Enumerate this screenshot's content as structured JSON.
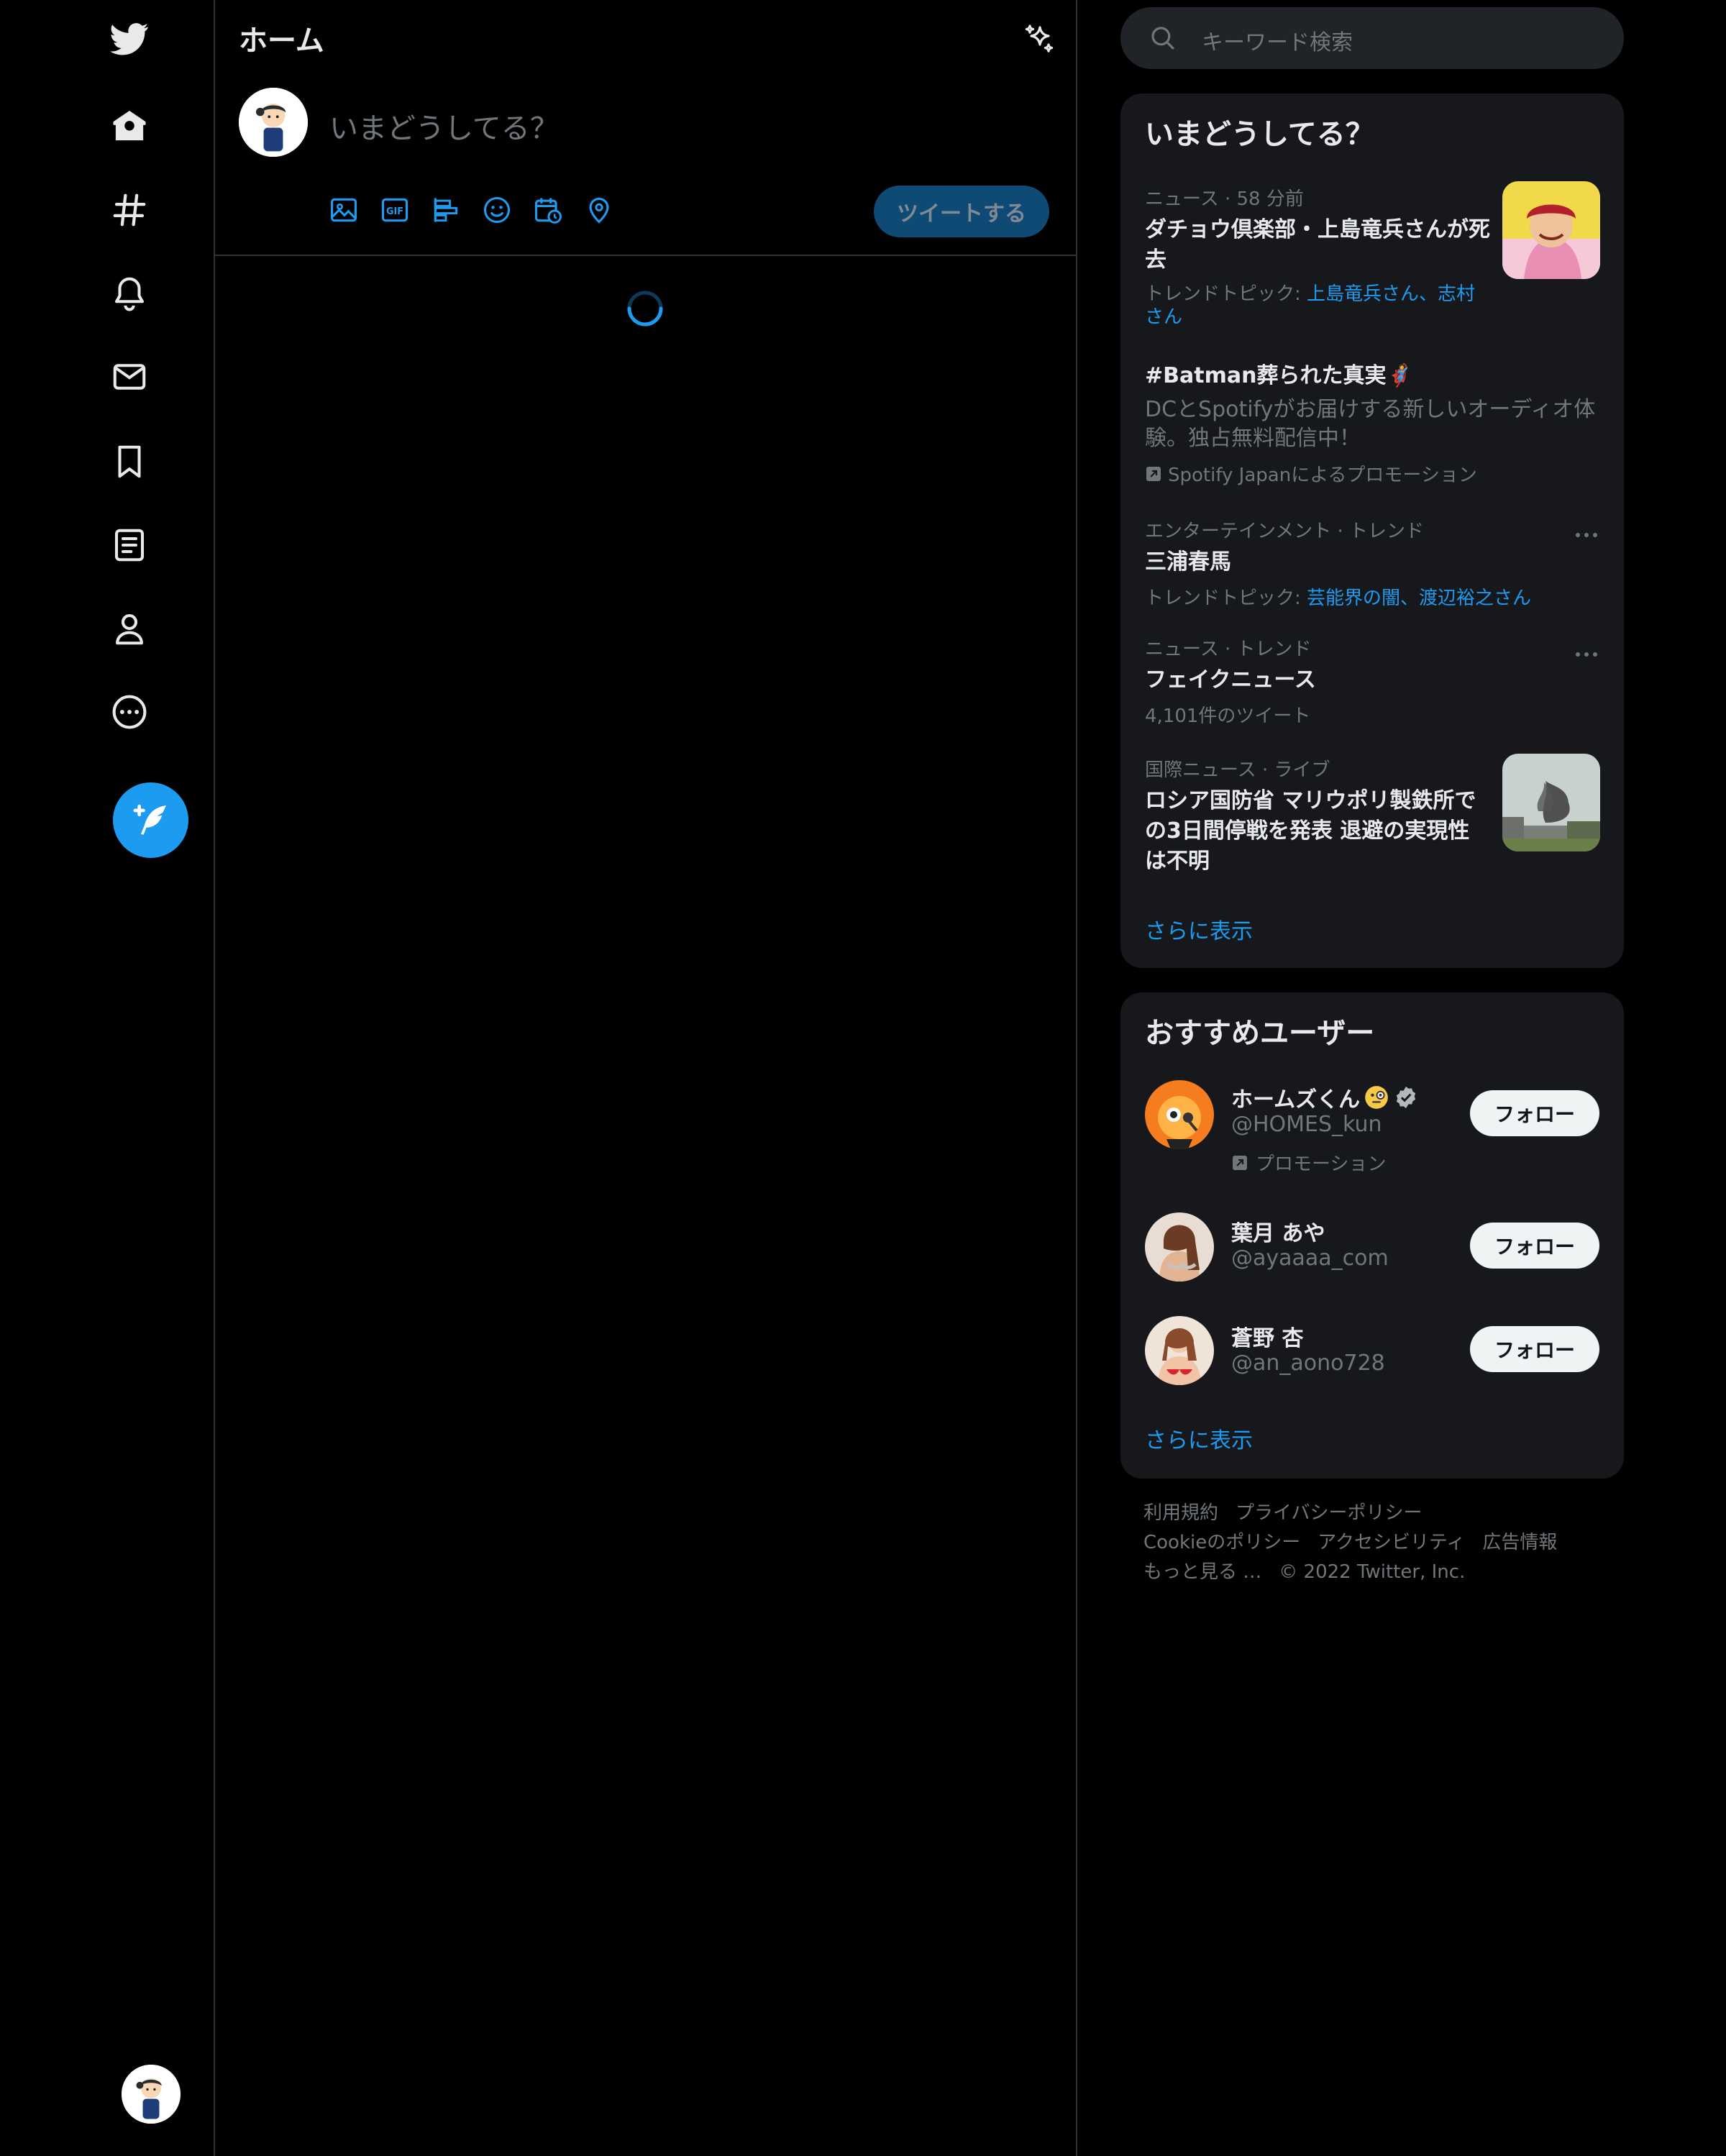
{
  "colors": {
    "accent": "#1d9bf0",
    "background": "#000000",
    "panel": "#16181c",
    "text": "#e7e9ea",
    "muted": "#71767b"
  },
  "nav": {
    "items": [
      {
        "icon": "twitter-bird-icon"
      },
      {
        "icon": "home-icon"
      },
      {
        "icon": "hashtag-icon"
      },
      {
        "icon": "bell-icon"
      },
      {
        "icon": "mail-icon"
      },
      {
        "icon": "bookmark-icon"
      },
      {
        "icon": "list-icon"
      },
      {
        "icon": "profile-icon"
      },
      {
        "icon": "more-circle-icon"
      }
    ],
    "compose_icon": "compose-feather-icon"
  },
  "main": {
    "title": "ホーム",
    "compose_placeholder": "いまどうしてる？",
    "tools": [
      "image-icon",
      "gif-icon",
      "poll-icon",
      "emoji-icon",
      "schedule-icon",
      "location-icon"
    ],
    "tweet_button": "ツイートする"
  },
  "search": {
    "placeholder": "キーワード検索"
  },
  "trends": {
    "title": "いまどうしてる？",
    "items": [
      {
        "meta": "ニュース · 58 分前",
        "headline": "ダチョウ倶楽部・上島竜兵さんが死去",
        "topic_label": "トレンドトピック: ",
        "topic_links": "上島竜兵さん、志村さん"
      },
      {
        "headline": "#Batman葬られた真実",
        "emoji": "🦸",
        "body": "DCとSpotifyがお届けする新しいオーディオ体験。独占無料配信中！",
        "promo": "Spotify Japanによるプロモーション"
      },
      {
        "meta": "エンターテインメント · トレンド",
        "headline": "三浦春馬",
        "topic_label": "トレンドトピック: ",
        "topic_links": "芸能界の闇、渡辺裕之さん"
      },
      {
        "meta": "ニュース · トレンド",
        "headline": "フェイクニュース",
        "count": "4,101件のツイート"
      },
      {
        "meta": "国際ニュース · ライブ",
        "headline": "ロシア国防省 マリウポリ製鉄所での3日間停戦を発表 退避の実現性は不明"
      }
    ],
    "show_more": "さらに表示"
  },
  "suggestions": {
    "title": "おすすめユーザー",
    "users": [
      {
        "name": "ホームズくん",
        "handle": "@HOMES_kun",
        "promo": "プロモーション",
        "follow": "フォロー"
      },
      {
        "name": "葉月 あや",
        "handle": "@ayaaaa_com",
        "follow": "フォロー"
      },
      {
        "name": "蒼野 杏",
        "handle": "@an_aono728",
        "follow": "フォロー"
      }
    ],
    "show_more": "さらに表示"
  },
  "footer": {
    "links": [
      "利用規約",
      "プライバシーポリシー",
      "Cookieのポリシー",
      "アクセシビリティ",
      "広告情報",
      "もっと見る …"
    ],
    "copyright": "© 2022 Twitter, Inc."
  }
}
